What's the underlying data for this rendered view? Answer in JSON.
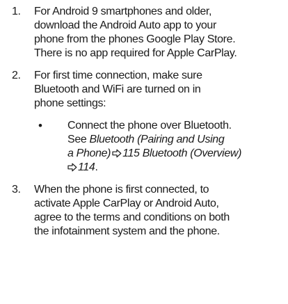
{
  "colors": {
    "text": "#1a1a1a",
    "background": "#ffffff"
  },
  "steps": [
    {
      "number": "1.",
      "lines": [
        "For Android 9 smartphones and older,",
        "download the Android Auto app to your",
        "phone from the phones Google Play Store.",
        "There is no app required for Apple CarPlay."
      ]
    },
    {
      "number": "2.",
      "lines": [
        "For first time connection, make sure",
        "Bluetooth and WiFi are turned on in",
        "phone settings:"
      ],
      "bullets": [
        {
          "symbol": "•",
          "line1": "Connect the phone over Bluetooth.",
          "see_prefix": "See ",
          "ref1_line1": "Bluetooth (Pairing and Using",
          "ref1_line2": "a Phone)",
          "ref1_page": "115",
          "ref2": "Bluetooth (Overview)",
          "ref2_page": "114",
          "end_period": "."
        }
      ]
    },
    {
      "number": "3.",
      "lines": [
        "When the phone is first connected, to",
        "activate Apple CarPlay or Android Auto,",
        "agree to the terms and conditions on both",
        "the infotainment system and the phone."
      ]
    }
  ],
  "icons": {
    "page_reference": "outline-right-arrow-icon"
  }
}
